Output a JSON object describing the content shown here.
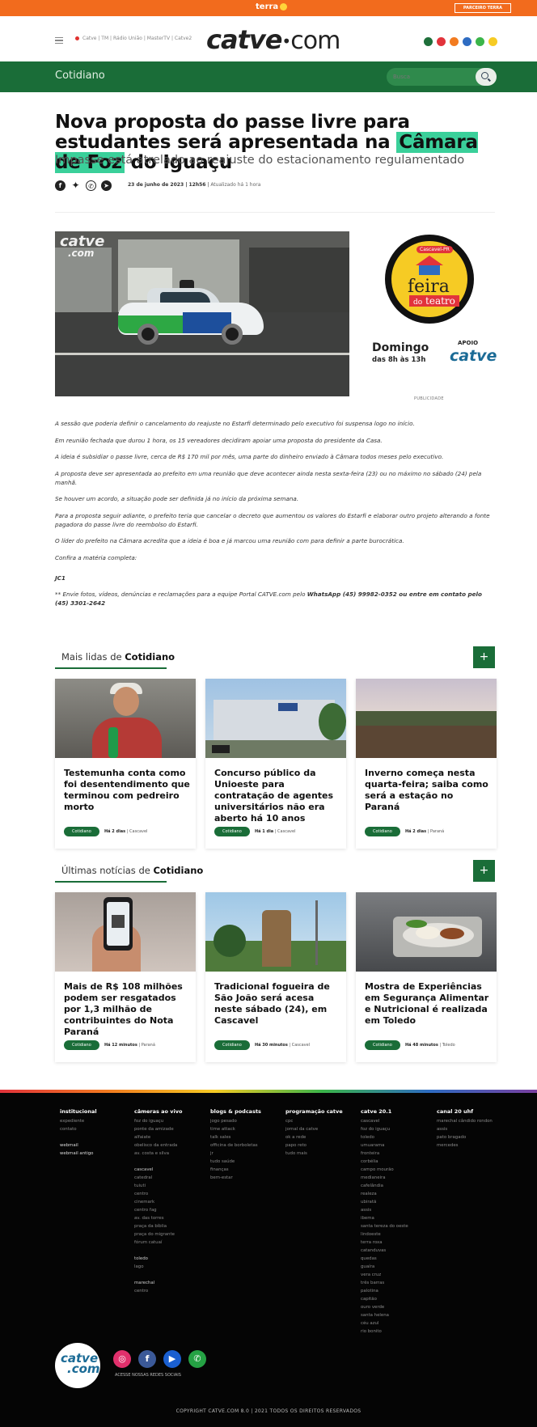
{
  "topbar": {
    "brand": "terra",
    "partner_button": "PARCEIRO TERRA"
  },
  "header": {
    "live_links": "Catve | TM | Rádio União | MasterTV | Catve2",
    "logo_main": "catve",
    "logo_dot": "•",
    "logo_com": "com",
    "dot_colors": [
      "#1e6f3a",
      "#e2333b",
      "#f27b20",
      "#2e6cc2",
      "#3bb54a",
      "#f6cb24"
    ]
  },
  "section_bar": {
    "title": "Cotidiano",
    "search_placeholder": "Busca"
  },
  "article": {
    "title_part1": "Nova proposta do passe livre para estudantes será apresentada na ",
    "title_highlight": "Câmara de Foz",
    "title_part2": " do Iguaçu",
    "subtitle": "Impasse está atrelado ao reajuste do estacionamento regulamentado",
    "date": "23 de junho de 2023 | 12h56",
    "updated": "Atualizado há 1 hora",
    "paragraphs": [
      "A sessão que poderia definir o cancelamento do reajuste no Estarfi determinado pelo executivo foi suspensa logo no início.",
      "Em reunião fechada que durou 1 hora, os 15 vereadores decidiram apoiar uma proposta do presidente da Casa.",
      "A ideia é subsidiar o passe livre, cerca de R$ 170 mil por mês, uma parte do dinheiro enviado à Câmara todos meses pelo executivo.",
      "A proposta deve ser apresentada ao prefeito em uma reunião que deve acontecer ainda nesta sexta-feira (23) ou no máximo no sábado (24) pela manhã.",
      "Se houver um acordo, a situação pode ser definida já no início da próxima semana.",
      "Para a proposta seguir adiante, o prefeito teria que cancelar o decreto que aumentou os valores do Estarfi e elaborar outro projeto alterando a fonte pagadora do passe livre do reembolso do Estarfi.",
      "O líder do prefeito na Câmara acredita que a ideia é boa e já marcou uma reunião com para definir a parte burocrática.",
      "Confira a matéria completa:"
    ],
    "credit": "JC1",
    "note_prefix": "** Envie fotos, vídeos, denúncias e reclamações para a equipe Portal CATVE.com pelo ",
    "note_bold": "WhatsApp (45) 99982-0352 ou entre em contato pelo (45) 3301-2642",
    "photo_watermark": "catve",
    "photo_watermark_sub": ".com"
  },
  "ad": {
    "city": "Cascavel-PR",
    "feira": "feira",
    "do": "do",
    "teatro": "teatro",
    "day": "Domingo",
    "hours": "das 8h às 13h",
    "support": "APOIO",
    "sponsor": "catve",
    "label": "PUBLICIDADE"
  },
  "most_read": {
    "label_prefix": "Mais lidas de ",
    "label_bold": "Cotidiano",
    "plus": "+",
    "cards": [
      {
        "title": "Testemunha conta como foi desentendimento que terminou com pedreiro morto",
        "tag": "Cotidiano",
        "time": "Há 2 dias",
        "place": "| Cascavel"
      },
      {
        "title": "Concurso público da Unioeste para contratação de agentes universitários não era aberto há 10 anos",
        "tag": "Cotidiano",
        "time": "Há 1 dia",
        "place": "| Cascavel"
      },
      {
        "title": "Inverno começa nesta quarta-feira; saiba como será a estação no Paraná",
        "tag": "Cotidiano",
        "time": "Há 2 dias",
        "place": "| Paraná"
      }
    ]
  },
  "latest": {
    "label_prefix": "Últimas notícias de ",
    "label_bold": "Cotidiano",
    "plus": "+",
    "cards": [
      {
        "title": "Mais de R$ 108 milhões podem ser resgatados por 1,3 milhão de contribuintes do Nota Paraná",
        "tag": "Cotidiano",
        "time": "Há 12 minutos",
        "place": "| Paraná"
      },
      {
        "title": "Tradicional fogueira de São João será acesa neste sábado (24), em Cascavel",
        "tag": "Cotidiano",
        "time": "Há 30 minutos",
        "place": "| Cascavel"
      },
      {
        "title": "Mostra de Experiências em Segurança Alimentar e Nutricional é realizada em Toledo",
        "tag": "Cotidiano",
        "time": "Há 48 minutos",
        "place": "| Toledo"
      }
    ]
  },
  "footer": {
    "col1": {
      "head": "institucional",
      "items": [
        "expediente",
        "contato"
      ],
      "sub_items": [
        "webmail",
        "webmail antigo"
      ]
    },
    "col2": {
      "head": "câmeras ao vivo",
      "items": [
        "foz do iguaçu",
        "ponte da amizade",
        "alfaiate",
        "obelisco da entrada",
        "av. costa e silva"
      ],
      "group2_head": "cascavel",
      "group2": [
        "catedral",
        "tuiuti",
        "centro",
        "cinemark",
        "centro fag",
        "av. das torres",
        "praça da bíblia",
        "praça do migrante",
        "fórum catuaí"
      ],
      "group3_head": "toledo",
      "group3": [
        "lago"
      ],
      "group4_head": "marechal",
      "group4": [
        "centro"
      ]
    },
    "col3": {
      "head": "blogs & podcasts",
      "items": [
        "jogo pesado",
        "time attack",
        "talk sales",
        "officina de borboletas",
        "jr",
        "tudo saúde",
        "finanças",
        "bem-estar"
      ]
    },
    "col4": {
      "head": "programação catve",
      "items": [
        "cpc",
        "jornal da catve",
        "ok a rede",
        "papo reto",
        "tudo mais"
      ]
    },
    "col5": {
      "head": "catve 20.1",
      "items": [
        "cascavel",
        "foz do iguaçu",
        "toledo",
        "umuarama",
        "fronteira",
        "corbélia",
        "campo mourão",
        "medianeira",
        "cafelândia",
        "realeza",
        "ubiratã",
        "assis",
        "ibema",
        "santa tereza do oeste",
        "lindoeste",
        "terra roxa",
        "catanduvas",
        "quedas",
        "guaíra",
        "vera cruz",
        "três barras",
        "palotina",
        "capitão",
        "ouro verde",
        "santa helena",
        "céu azul",
        "rio bonito"
      ]
    },
    "col6": {
      "head": "canal 20 uhf",
      "items": [
        "marechal cândido rondon",
        "assis",
        "pato bragado",
        "mercedes"
      ]
    },
    "social_label": "ACESSE NOSSAS REDES SOCIAIS",
    "logo": "catve",
    "logo_sub": ".com",
    "copyright": "COPYRIGHT CATVE.COM 8.0 | 2021 TODOS OS DIREITOS RESERVADOS"
  }
}
